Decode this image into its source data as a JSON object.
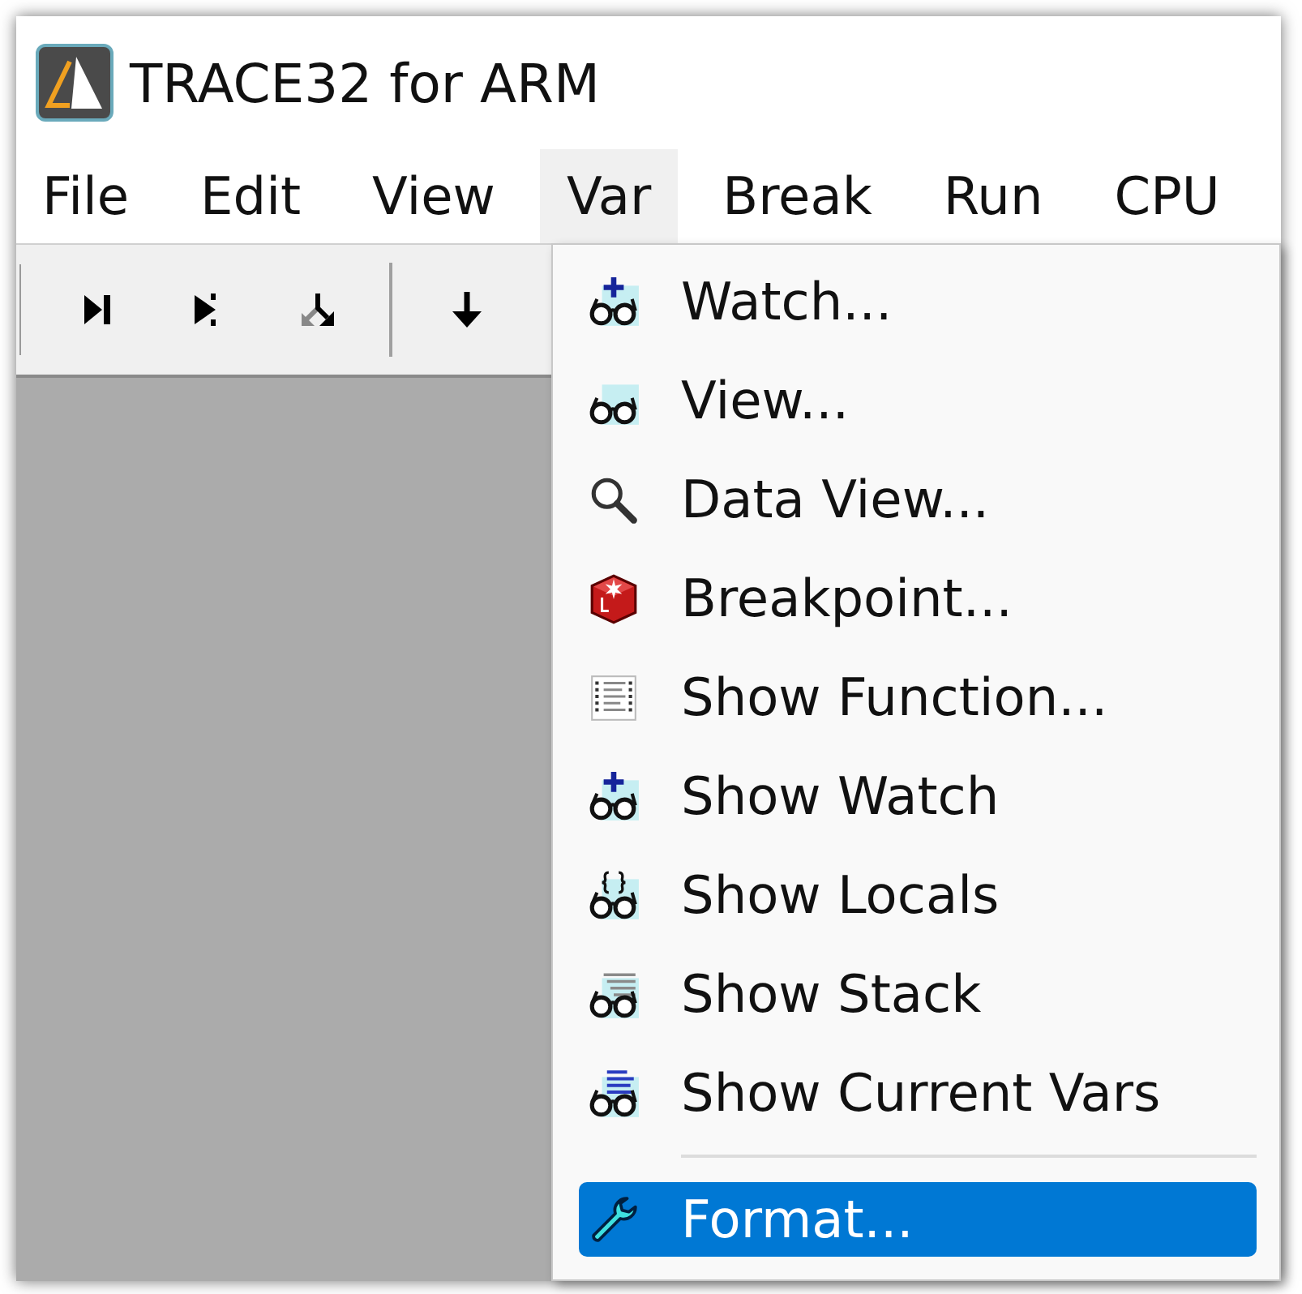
{
  "window": {
    "title": "TRACE32 for ARM"
  },
  "menu_bar": [
    {
      "label": "File",
      "selected": false
    },
    {
      "label": "Edit",
      "selected": false
    },
    {
      "label": "View",
      "selected": false
    },
    {
      "label": "Var",
      "selected": true
    },
    {
      "label": "Break",
      "selected": false
    },
    {
      "label": "Run",
      "selected": false
    },
    {
      "label": "CPU",
      "selected": false
    }
  ],
  "var_menu": {
    "items": [
      {
        "kind": "command",
        "label": "Watch...",
        "selected": false
      },
      {
        "kind": "command",
        "label": "View...",
        "selected": false
      },
      {
        "kind": "command",
        "label": "Data View...",
        "selected": false
      },
      {
        "kind": "command",
        "label": "Breakpoint...",
        "selected": false
      },
      {
        "kind": "command",
        "label": "Show Function...",
        "selected": false
      },
      {
        "kind": "command",
        "label": "Show Watch",
        "selected": false
      },
      {
        "kind": "command",
        "label": "Show Locals",
        "selected": false
      },
      {
        "kind": "command",
        "label": "Show Stack",
        "selected": false
      },
      {
        "kind": "command",
        "label": "Show Current Vars",
        "selected": false
      },
      {
        "kind": "separator"
      },
      {
        "kind": "command",
        "label": "Format...",
        "selected": true
      }
    ]
  }
}
